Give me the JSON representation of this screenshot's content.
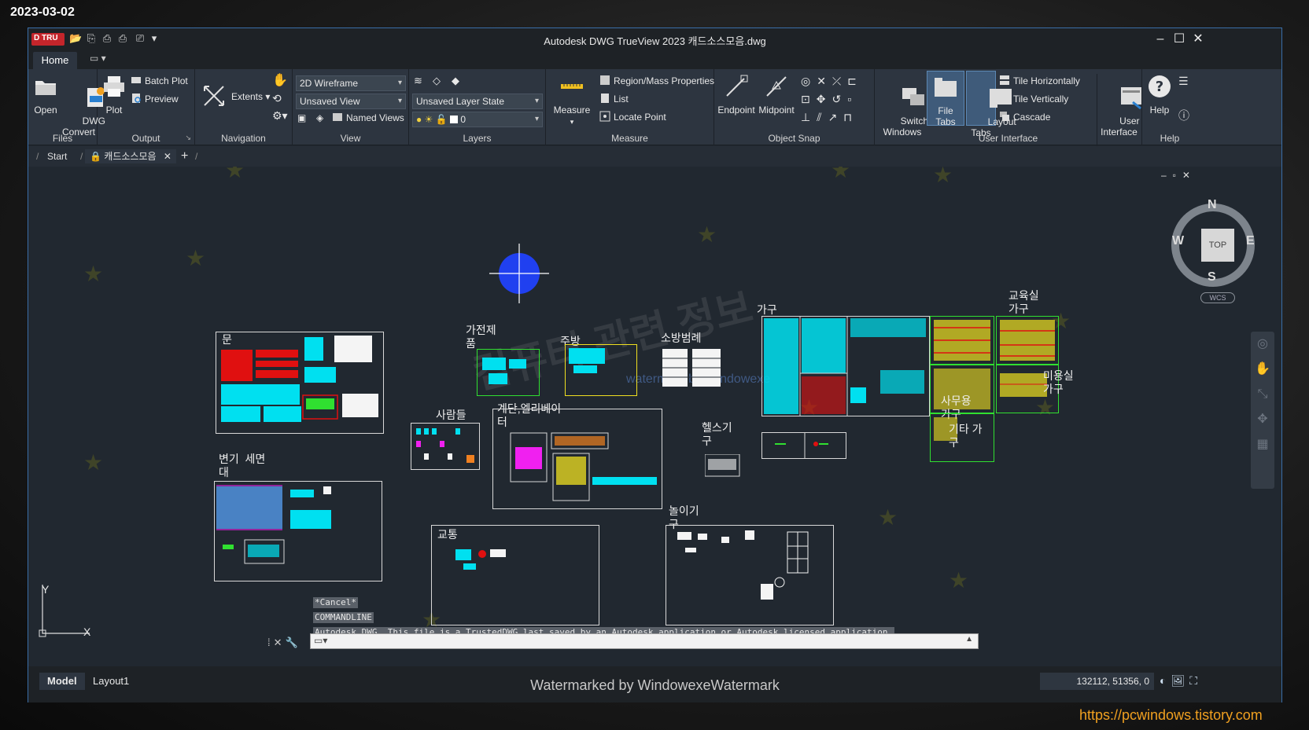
{
  "overlay": {
    "date": "2023-03-02",
    "blog_url": "https://pcwindows.tistory.com"
  },
  "app": {
    "logo": "D TRU",
    "title": "Autodesk DWG TrueView 2023    캐드소스모음.dwg"
  },
  "ribbon_tabs": {
    "home": "Home"
  },
  "panels": {
    "files": {
      "title": "Files",
      "open": "Open",
      "dwg_convert": "DWG\nConvert"
    },
    "output": {
      "title": "Output",
      "plot": "Plot",
      "batch_plot": "Batch Plot",
      "preview": "Preview"
    },
    "navigation": {
      "title": "Navigation",
      "extents": "Extents"
    },
    "view": {
      "title": "View",
      "visual_style": "2D Wireframe",
      "named_view": "Unsaved View",
      "named_views": "Named Views"
    },
    "layers": {
      "title": "Layers",
      "layer_state": "Unsaved Layer State",
      "current_layer": "0"
    },
    "measure": {
      "title": "Measure",
      "measure": "Measure",
      "region_mass": "Region/Mass Properties",
      "list": "List",
      "locate_point": "Locate Point"
    },
    "object_snap": {
      "title": "Object Snap",
      "endpoint": "Endpoint",
      "midpoint": "Midpoint"
    },
    "user_interface": {
      "title": "User Interface",
      "switch_windows": "Switch\nWindows",
      "file_tabs": "File Tabs",
      "layout_tabs": "Layout\nTabs",
      "tile_horizontally": "Tile Horizontally",
      "tile_vertically": "Tile Vertically",
      "cascade": "Cascade",
      "user_interface": "User\nInterface"
    },
    "help": {
      "title": "Help",
      "help": "Help"
    }
  },
  "doc_tabs": {
    "start": "Start",
    "file": "캐드소스모음"
  },
  "canvas": {
    "labels": {
      "door": "문",
      "appliance": "가전제\n품",
      "kitchen": "주방",
      "fire": "소방범례",
      "furniture": "가구",
      "classroom": "교육실\n가구",
      "beauty": "미용실\n가구",
      "people": "사람들",
      "stairs": "계단,엘리베이\n터",
      "office": "사무용\n가구",
      "other": "기타 가\n구",
      "gym": "헬스기\n구",
      "toilet": "변기  세면\n대",
      "transport": "교통",
      "playground": "놀이기\n구",
      "watermark_center": "watermark by Windowexe",
      "watermark_korean": "컴퓨터 관련 정보"
    },
    "viewcube": {
      "n": "N",
      "s": "S",
      "e": "E",
      "w": "W",
      "top": "TOP",
      "wcs": "WCS"
    },
    "ucs": {
      "x": "X",
      "y": "Y"
    },
    "command_history": [
      "*Cancel*",
      "COMMANDLINE",
      "Autodesk DWG.  This file is a TrustedDWG last saved by an Autodesk application or Autodesk licensed application."
    ]
  },
  "status": {
    "model": "Model",
    "layout1": "Layout1",
    "watermark": "Watermarked by WindowexeWatermark",
    "coordinates": "132112, 51356, 0"
  },
  "colors": {
    "accent": "#3a6ea8",
    "cyan": "#00e0f0",
    "red": "#e01010",
    "yellow": "#f0e020",
    "green": "#30e030",
    "magenta": "#f020f0",
    "blue_circle": "#2040f0"
  }
}
